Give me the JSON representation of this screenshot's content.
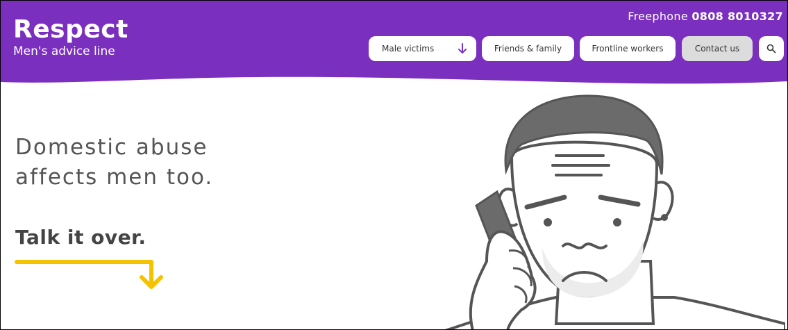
{
  "brand": {
    "name": "Respect",
    "subtitle": "Men's advice line",
    "primary_color": "#7b2fbf"
  },
  "contact": {
    "prefix": "Freephone",
    "number": "0808 8010327"
  },
  "nav": {
    "items": [
      {
        "label": "Male victims",
        "has_dropdown": true
      },
      {
        "label": "Friends & family"
      },
      {
        "label": "Frontline workers"
      },
      {
        "label": "Contact us",
        "active": true
      }
    ],
    "search_icon": "search-icon",
    "dropdown_icon": "arrow-down-icon"
  },
  "hero": {
    "headline_line1": "Domestic abuse",
    "headline_line2": "affects men too.",
    "tagline": "Talk it over.",
    "accent_color": "#f5c200"
  }
}
